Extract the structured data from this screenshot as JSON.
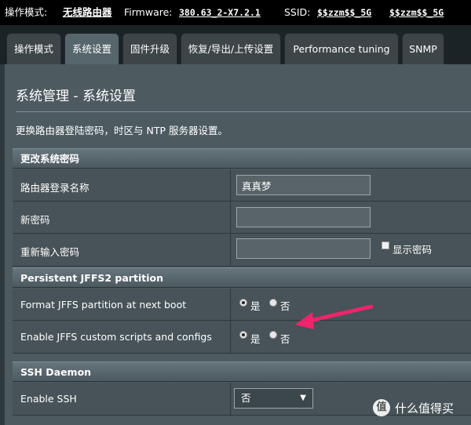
{
  "topbar": {
    "mode_label": "操作模式:",
    "mode_value": "无线路由器",
    "firmware_label": "Firmware:",
    "firmware_value": "380.63_2-X7.2.1",
    "ssid_label": "SSID:",
    "ssid_1": "$$zzm$$_5G",
    "ssid_2": "$$zzm$$_5G"
  },
  "tabs": [
    {
      "label": "操作模式"
    },
    {
      "label": "系统设置",
      "active": true
    },
    {
      "label": "固件升级"
    },
    {
      "label": "恢复/导出/上传设置"
    },
    {
      "label": "Performance tuning"
    },
    {
      "label": "SNMP"
    }
  ],
  "page": {
    "title": "系统管理 - 系统设置",
    "description": "更换路由器登陆密码，时区与 NTP 服务器设置。"
  },
  "sections": {
    "password": {
      "header": "更改系统密码",
      "login_name_label": "路由器登录名称",
      "login_name_value": "真真梦",
      "new_password_label": "新密码",
      "new_password_value": "",
      "retype_password_label": "重新输入密码",
      "retype_password_value": "",
      "show_password_label": "显示密码"
    },
    "jffs": {
      "header": "Persistent JFFS2 partition",
      "format_label": "Format JFFS partition at next boot",
      "format_selected": "是",
      "enable_scripts_label": "Enable JFFS custom scripts and configs",
      "enable_scripts_selected": "是",
      "yes": "是",
      "no": "否"
    },
    "ssh": {
      "header": "SSH Daemon",
      "enable_label": "Enable SSH",
      "enable_value": "否"
    }
  },
  "annotation": {
    "color": "#f0246a"
  },
  "watermark": {
    "logo": "值",
    "text": "什么值得买"
  }
}
